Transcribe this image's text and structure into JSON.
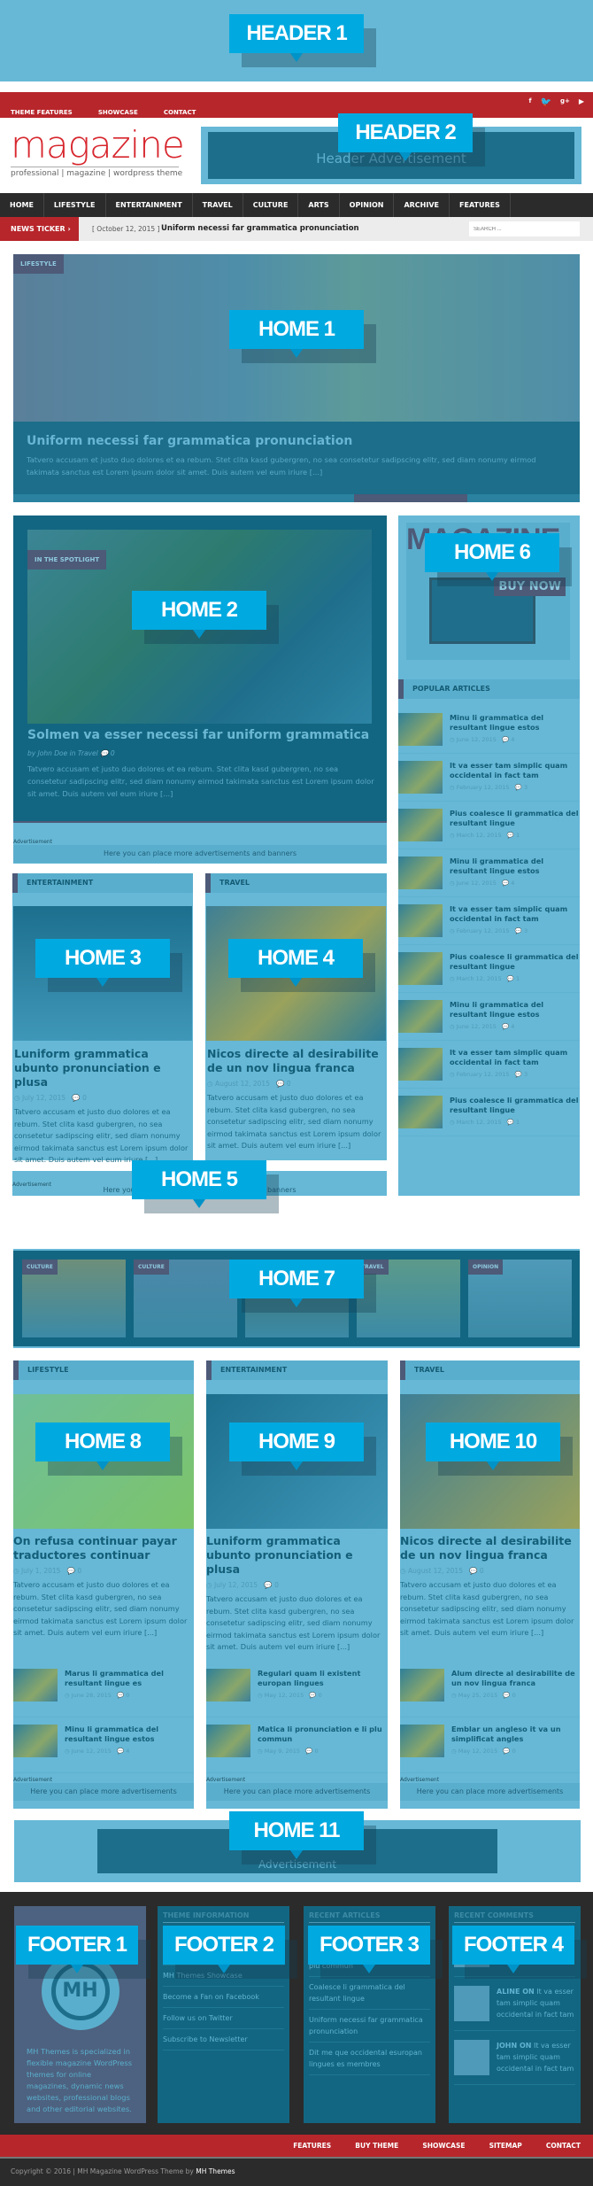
{
  "labels": {
    "header1": "HEADER 1",
    "header2": "HEADER 2",
    "home1": "HOME 1",
    "home2": "HOME 2",
    "home3": "HOME 3",
    "home4": "HOME 4",
    "home5": "HOME 5",
    "home6": "HOME 6",
    "home7": "HOME 7",
    "home8": "HOME 8",
    "home9": "HOME 9",
    "home10": "HOME 10",
    "home11": "HOME 11",
    "footer1": "FOOTER 1",
    "footer2": "FOOTER 2",
    "footer3": "FOOTER 3",
    "footer4": "FOOTER 4"
  },
  "colors": {
    "red": "#b7262b",
    "dark": "#2b2b2b",
    "overlay_light": "#66b8d6",
    "overlay_dark": "#136681",
    "label": "#00a9e0"
  },
  "topbar": {
    "links": [
      "THEME FEATURES",
      "SHOWCASE",
      "CONTACT"
    ],
    "social_icons": [
      "facebook-icon",
      "twitter-icon",
      "google-plus-icon",
      "youtube-icon"
    ]
  },
  "logo": {
    "name": "magazine",
    "tagline": "professional | magazine | wordpress theme"
  },
  "header_ad": "Header Advertisement",
  "nav": [
    "HOME",
    "LIFESTYLE",
    "ENTERTAINMENT",
    "TRAVEL",
    "CULTURE",
    "ARTS",
    "OPINION",
    "ARCHIVE",
    "FEATURES"
  ],
  "ticker": {
    "label": "NEWS TICKER",
    "date": "[ October 12, 2015 ]",
    "headline": "Uniform necessi far grammatica pronunciation",
    "search_placeholder": "SEARCH ..."
  },
  "excerpt": "Tatvero accusam et justo duo dolores et ea rebum. Stet clita kasd gubergren, no sea consetetur sadipscing elitr, sed diam nonumy eirmod takimata sanctus est Lorem ipsum dolor sit amet. Duis autem vel eum iriure [...]",
  "home1": {
    "category": "LIFESTYLE",
    "title": "Uniform necessi far grammatica pronunciation"
  },
  "home2": {
    "category": "IN THE SPOTLIGHT",
    "title": "Solmen va esser necessi far uniform grammatica",
    "byline": "by John Doe in Travel",
    "comments": "0",
    "ad_label": "Advertisement",
    "ad_text": "Here you can place more advertisements and banners"
  },
  "home3": {
    "widget_title": "ENTERTAINMENT",
    "title": "Luniform grammatica ubunto pronunciation e plusa",
    "date": "July 12, 2015",
    "comments": "0"
  },
  "home4": {
    "widget_title": "TRAVEL",
    "title": "Nicos directe al desirabilite de un nov lingua franca",
    "date": "August 12, 2015",
    "comments": "0"
  },
  "home5": {
    "ad_label": "Advertisement",
    "ad_text": "Here you can place more advertisements and banners"
  },
  "home6": {
    "banner": "MAGAZINE",
    "buy": "BUY NOW",
    "widget_title": "POPULAR ARTICLES",
    "items": [
      {
        "title": "Minu li grammatica del resultant lingue estos",
        "date": "June 12, 2015",
        "comments": "4"
      },
      {
        "title": "It va esser tam simplic quam occidental in fact tam",
        "date": "February 12, 2015",
        "comments": "3"
      },
      {
        "title": "Pius coalesce li grammatica del resultant lingue",
        "date": "March 12, 2015",
        "comments": "1"
      },
      {
        "title": "Minu li grammatica del resultant lingue estos",
        "date": "June 12, 2015",
        "comments": "4"
      },
      {
        "title": "It va esser tam simplic quam occidental in fact tam",
        "date": "February 12, 2015",
        "comments": "3"
      },
      {
        "title": "Pius coalesce li grammatica del resultant lingue",
        "date": "March 12, 2015",
        "comments": "1"
      },
      {
        "title": "Minu li grammatica del resultant lingue estos",
        "date": "June 12, 2015",
        "comments": "4"
      },
      {
        "title": "It va esser tam simplic quam occidental in fact tam",
        "date": "February 12, 2015",
        "comments": "3"
      },
      {
        "title": "Pius coalesce li grammatica del resultant lingue",
        "date": "March 12, 2015",
        "comments": "1"
      }
    ]
  },
  "home7": {
    "cats": [
      "CULTURE",
      "CULTURE",
      "",
      "TRAVEL",
      "OPINION"
    ]
  },
  "cols": [
    {
      "widget_title": "LIFESTYLE",
      "title": "On refusa continuar payar traductores continuar",
      "date": "July 1, 2015",
      "comments": "0",
      "small": [
        {
          "title": "Marus li grammatica del resultant lingue es",
          "date": "June 28, 2015",
          "comments": "0"
        },
        {
          "title": "Minu li grammatica del resultant lingue estos",
          "date": "June 12, 2015",
          "comments": "4"
        }
      ],
      "ad_label": "Advertisement",
      "ad_text": "Here you can place more advertisements"
    },
    {
      "widget_title": "ENTERTAINMENT",
      "title": "Luniform grammatica ubunto pronunciation e plusa",
      "date": "July 12, 2015",
      "comments": "0",
      "small": [
        {
          "title": "Regulari quam li existent europan lingues",
          "date": "May 12, 2015",
          "comments": "0"
        },
        {
          "title": "Matica li pronunciation e li plu commun",
          "date": "May 9, 2015",
          "comments": "0"
        }
      ],
      "ad_label": "Advertisement",
      "ad_text": "Here you can place more advertisements"
    },
    {
      "widget_title": "TRAVEL",
      "title": "Nicos directe al desirabilite de un nov lingua franca",
      "date": "August 12, 2015",
      "comments": "0",
      "small": [
        {
          "title": "Alum directe al desirabilite de un nov lingua franca",
          "date": "May 25, 2015",
          "comments": "0"
        },
        {
          "title": "Emblar un angleso it va un simplificat angles",
          "date": "May 12, 2015",
          "comments": "0"
        }
      ],
      "ad_label": "Advertisement",
      "ad_text": "Here you can place more advertisements"
    }
  ],
  "home11": {
    "ad": "Advertisement"
  },
  "footer1": {
    "logo": "MH",
    "text": "MH Themes is specialized in flexible magazine WordPress themes for online magazines, dynamic news websites, professional blogs and other editorial websites."
  },
  "footer2": {
    "title": "THEME INFORMATION",
    "links": [
      "F...",
      "More Themes by MH Themes",
      "MH Themes Showcase",
      "Become a Fan on Facebook",
      "Follow us on Twitter",
      "Subscribe to Newsletter"
    ]
  },
  "footer3": {
    "title": "RECENT ARTICLES",
    "links": [
      "F... quam li existent",
      "Teos matica li pronunciation e li plu commun",
      "Coalesce li grammatica del resultant lingue",
      "Uniform necessi far grammatica pronunciation",
      "Dit me que occidental esuropan lingues es membres"
    ]
  },
  "footer4": {
    "title": "RECENT COMMENTS",
    "items": [
      {
        "who": "",
        "text": "... li grammatica del resultant lingue"
      },
      {
        "who": "ALINE ON",
        "text": "It va esser tam simplic quam occidental in fact tam"
      },
      {
        "who": "JOHN ON",
        "text": "It va esser tam simplic quam occidental in fact tam"
      }
    ]
  },
  "footer_nav": [
    "FEATURES",
    "BUY THEME",
    "SHOWCASE",
    "SITEMAP",
    "CONTACT"
  ],
  "copyright": {
    "text": "Copyright © 2016 | MH Magazine WordPress Theme by",
    "brand": "MH Themes"
  }
}
